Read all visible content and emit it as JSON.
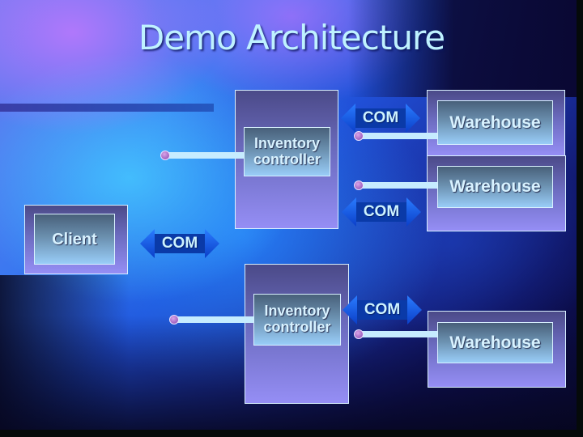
{
  "slide": {
    "title": "Demo Architecture"
  },
  "diagram": {
    "client": {
      "label": "Client"
    },
    "connectors": [
      {
        "label": "COM",
        "icon": "double-arrow-icon"
      },
      {
        "label": "COM",
        "icon": "double-arrow-icon"
      },
      {
        "label": "COM",
        "icon": "double-arrow-icon"
      },
      {
        "label": "COM",
        "icon": "double-arrow-icon"
      }
    ],
    "controllers": [
      {
        "line1": "Inventory",
        "line2": "controller"
      },
      {
        "line1": "Inventory",
        "line2": "controller"
      }
    ],
    "warehouses": [
      {
        "label": "Warehouse"
      },
      {
        "label": "Warehouse"
      },
      {
        "label": "Warehouse"
      }
    ],
    "interface_icon": "lollipop-interface-icon"
  }
}
